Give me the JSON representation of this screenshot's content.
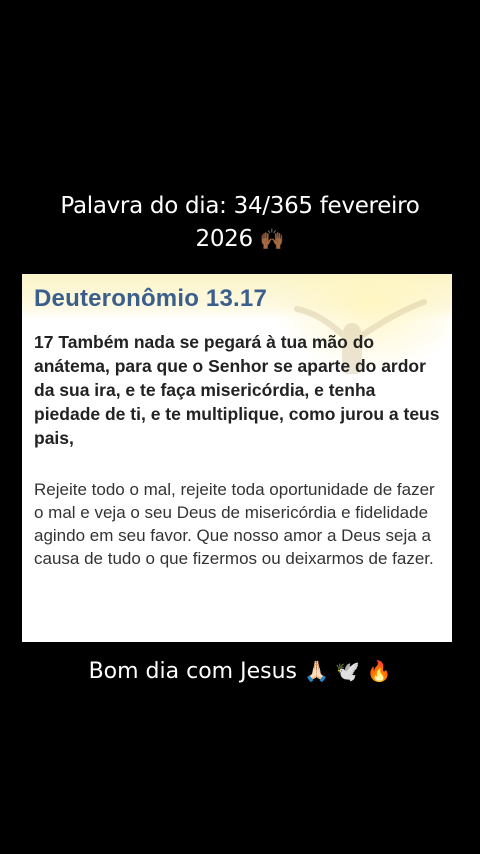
{
  "caption_top": {
    "line1": "Palavra do dia: 34/365 fevereiro",
    "line2": "2026",
    "emoji": "🙌🏾"
  },
  "card": {
    "title": "Deuteronômio 13.17",
    "verse": "17 Também nada se pegará à tua mão do anátema, para que o Senhor se aparte do ardor da sua ira, e te faça misericórdia, e tenha piedade de ti, e te multiplique, como jurou a teus pais,",
    "reflection": "Rejeite todo o mal, rejeite toda oportunidade de fazer o mal e veja o seu Deus de misericórdia e fidelidade agindo em seu favor. Que nosso amor a Deus seja a causa de tudo o que fizermos ou deixarmos de fazer."
  },
  "caption_bottom": {
    "text": "Bom dia com Jesus",
    "emojis": "🙏🏻 🕊️ 🔥"
  },
  "colors": {
    "background": "#000000",
    "title": "#3a5f8c",
    "card_header": "#fbf4c8"
  }
}
